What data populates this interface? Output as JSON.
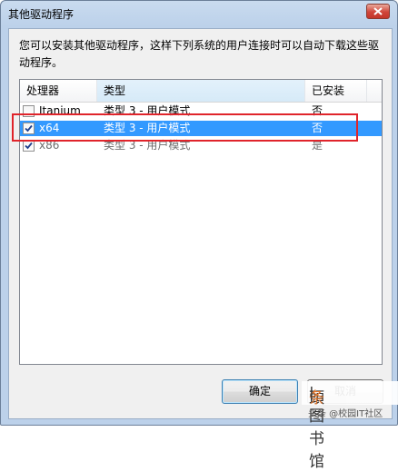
{
  "window": {
    "title": "其他驱动程序"
  },
  "description": "您可以安装其他驱动程序，这样下列系统的用户连接时可以自动下载这些驱动程序。",
  "list": {
    "headers": [
      "处理器",
      "类型",
      "已安装"
    ],
    "rows": [
      {
        "checked": false,
        "processor": "Itanium",
        "type": "类型 3 - 用户模式",
        "installed": "否"
      },
      {
        "checked": true,
        "processor": "x64",
        "type": "类型 3 - 用户模式",
        "installed": "否",
        "selected": true
      },
      {
        "checked": true,
        "processor": "x86",
        "type": "类型 3 - 用户模式",
        "installed": "是"
      }
    ]
  },
  "buttons": {
    "ok": "确定",
    "cancel": "取消"
  },
  "watermark": {
    "main_prefix": "頭",
    "main_orange": "条",
    "main_rest": "|图书馆",
    "footer": "头条 @校园IT社区"
  },
  "colors": {
    "selection": "#3399ff",
    "highlight": "#e0242b"
  }
}
